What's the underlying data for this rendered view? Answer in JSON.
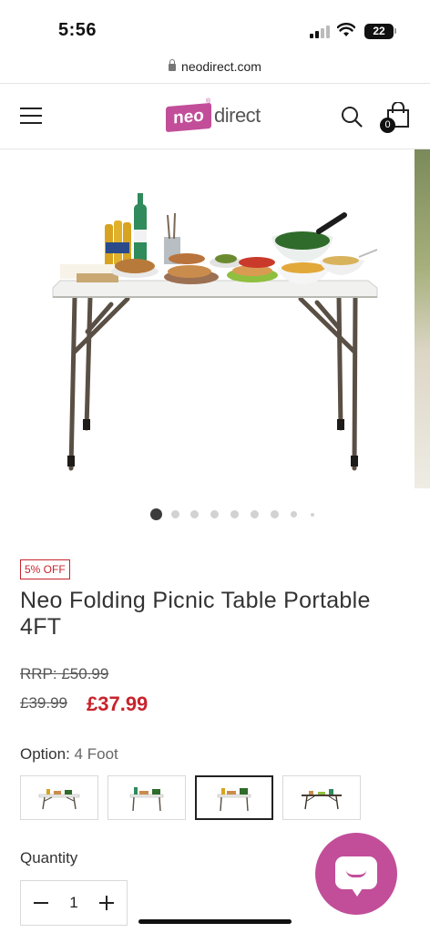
{
  "status_bar": {
    "time": "5:56",
    "battery": "22"
  },
  "browser": {
    "url": "neodirect.com"
  },
  "header": {
    "logo_neo": "neo",
    "logo_direct": "direct",
    "logo_reg": "®",
    "cart_count": "0"
  },
  "gallery": {
    "slide_count": 9,
    "active_slide": 1
  },
  "product": {
    "badge": "5% OFF",
    "title": "Neo Folding Picnic Table Portable 4FT",
    "rrp": "RRP: £50.99",
    "was_price": "£39.99",
    "price": "£37.99",
    "option_label": "Option:",
    "option_value": "4 Foot",
    "options": [
      {
        "label": "option-1",
        "selected": false
      },
      {
        "label": "option-2",
        "selected": false
      },
      {
        "label": "option-3",
        "selected": true
      },
      {
        "label": "option-4",
        "selected": false
      }
    ],
    "quantity_label": "Quantity",
    "quantity": "1"
  },
  "colors": {
    "brand_pink": "#c24e9a",
    "sale_red": "#c8232c"
  }
}
